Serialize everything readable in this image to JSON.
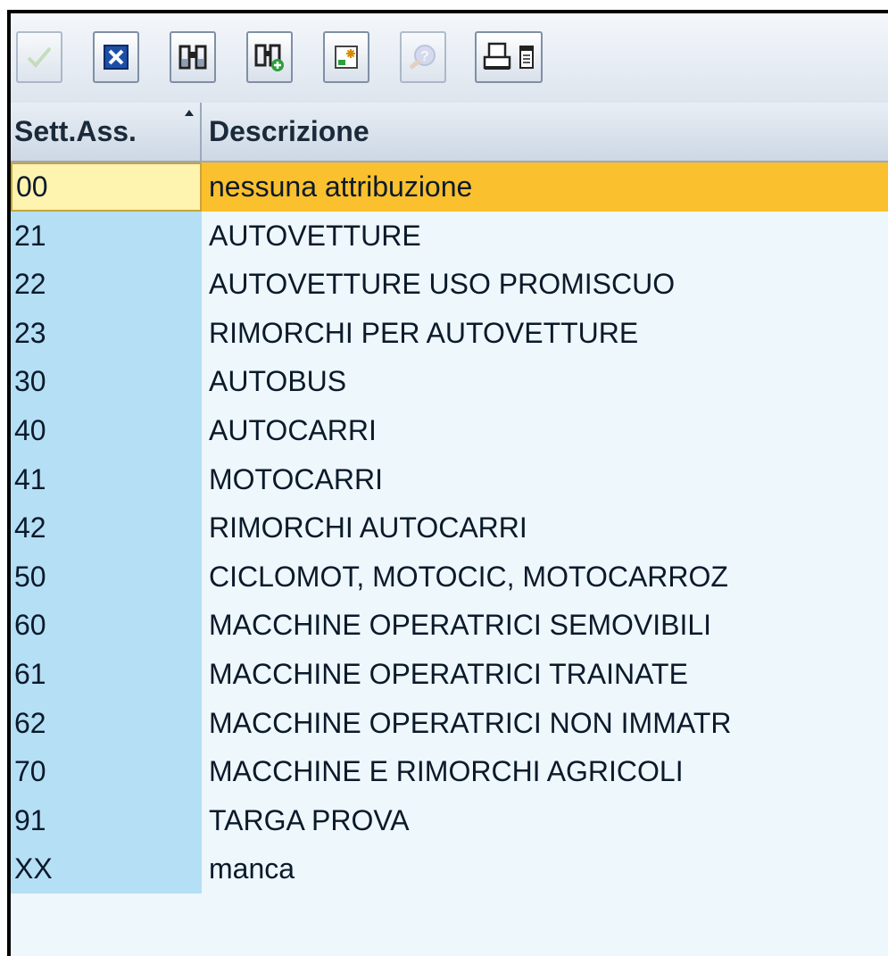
{
  "toolbar": {
    "buttons": [
      {
        "name": "confirm",
        "icon": "checkmark-icon",
        "enabled": false
      },
      {
        "name": "cancel",
        "icon": "close-icon",
        "enabled": true
      },
      {
        "name": "find",
        "icon": "binoculars-icon",
        "enabled": true
      },
      {
        "name": "find-next",
        "icon": "binoculars-plus-icon",
        "enabled": true
      },
      {
        "name": "new-entry",
        "icon": "new-item-icon",
        "enabled": true
      },
      {
        "name": "help",
        "icon": "help-icon",
        "enabled": false
      },
      {
        "name": "print",
        "icon": "printer-icon",
        "enabled": true
      },
      {
        "name": "list",
        "icon": "list-icon",
        "enabled": true
      }
    ]
  },
  "table": {
    "columns": {
      "key": "Sett.Ass.",
      "description": "Descrizione"
    },
    "sort_indicator": "ascending",
    "rows": [
      {
        "key": "00",
        "description": "nessuna attribuzione",
        "selected": true
      },
      {
        "key": "21",
        "description": "AUTOVETTURE"
      },
      {
        "key": "22",
        "description": "AUTOVETTURE USO PROMISCUO"
      },
      {
        "key": "23",
        "description": "RIMORCHI PER AUTOVETTURE"
      },
      {
        "key": "30",
        "description": "AUTOBUS"
      },
      {
        "key": "40",
        "description": "AUTOCARRI"
      },
      {
        "key": "41",
        "description": "MOTOCARRI"
      },
      {
        "key": "42",
        "description": "RIMORCHI AUTOCARRI"
      },
      {
        "key": "50",
        "description": "CICLOMOT, MOTOCIC, MOTOCARROZ"
      },
      {
        "key": "60",
        "description": "MACCHINE OPERATRICI SEMOVIBILI"
      },
      {
        "key": "61",
        "description": "MACCHINE OPERATRICI TRAINATE"
      },
      {
        "key": "62",
        "description": "MACCHINE OPERATRICI NON IMMATR"
      },
      {
        "key": "70",
        "description": "MACCHINE E RIMORCHI AGRICOLI"
      },
      {
        "key": "91",
        "description": "TARGA PROVA"
      },
      {
        "key": "XX",
        "description": "manca"
      }
    ]
  },
  "colors": {
    "key_column": "#b5dff5",
    "row_background": "#eef7fc",
    "selected_row": "#fbc02d",
    "selected_key": "#fff3b0"
  }
}
